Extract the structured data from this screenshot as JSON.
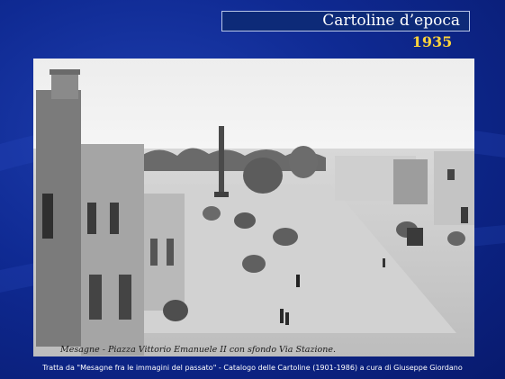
{
  "slide": {
    "title": "Cartoline d’epoca",
    "year": "1935",
    "photo_caption": "Mesagne - Piazza Vittorio Emanuele II con sfondo Via Stazione.",
    "credit": "Tratta da \"Mesagne fra le immagini del passato\" - Catalogo delle Cartoline (1901-1986) a cura di Giuseppe Giordano"
  },
  "colors": {
    "background": "#0f2a93",
    "title_box": "#0d2a78",
    "year_text": "#ffd43a",
    "credit_text": "#ffffff"
  }
}
